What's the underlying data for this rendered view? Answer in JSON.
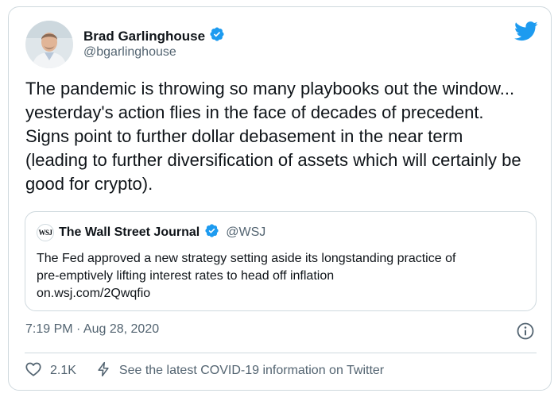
{
  "author": {
    "display_name": "Brad Garlinghouse",
    "handle": "@bgarlinghouse"
  },
  "tweet": {
    "text": "The pandemic is throwing so many playbooks out the window... yesterday's action flies in the face of decades of precedent. Signs point to further dollar debasement in the near term (leading to further diversification of assets which will certainly be good for crypto).",
    "timestamp": "7:19 PM · Aug 28, 2020"
  },
  "quote": {
    "logo_text": "WSJ",
    "display_name": "The Wall Street Journal",
    "handle": "@WSJ",
    "text_line1": "The Fed approved a new strategy setting aside its longstanding practice of",
    "text_line2": "pre-emptively lifting interest rates to head off inflation",
    "link": "on.wsj.com/2Qwqfio"
  },
  "footer": {
    "like_count": "2.1K",
    "covid_text": "See the latest COVID-19 information on Twitter"
  },
  "icons": {
    "twitter": "twitter-bird-icon",
    "verified": "verified-badge-icon",
    "info": "info-icon",
    "like": "heart-icon",
    "covid": "lightning-icon"
  },
  "colors": {
    "brand_blue": "#1d9bf0",
    "text_primary": "#0f1419",
    "text_secondary": "#536471",
    "border": "#cfd9de"
  }
}
